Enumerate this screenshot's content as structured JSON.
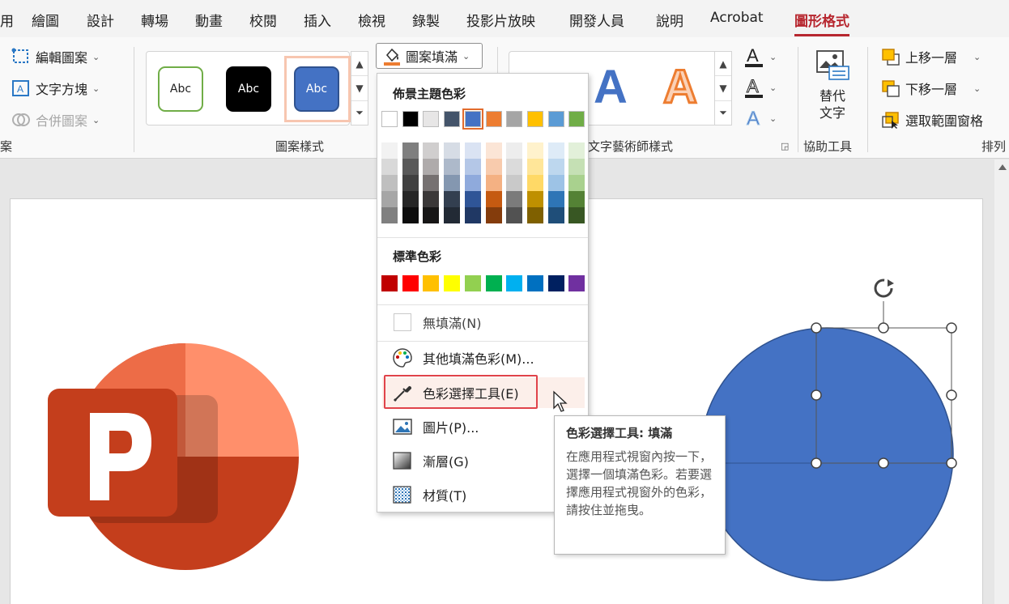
{
  "tabs": [
    "用",
    "繪圖",
    "設計",
    "轉場",
    "動畫",
    "校閱",
    "插入",
    "檢視",
    "錄製",
    "投影片放映",
    "開發人員",
    "說明",
    "Acrobat",
    "圖形格式"
  ],
  "active_tab": "圖形格式",
  "ribbon": {
    "insert_shapes": {
      "edit_shape": "編輯圖案",
      "text_box": "文字方塊",
      "merge_shapes": "合併圖案",
      "label_partial": "案"
    },
    "shape_styles": {
      "label": "圖案樣式",
      "presets": [
        "Abc",
        "Abc",
        "Abc"
      ],
      "fill_button": "圖案填滿"
    },
    "wordart": {
      "label": "文字藝術師樣式",
      "letters": [
        "A",
        "A"
      ]
    },
    "accessibility": {
      "alt_text_line1": "替代",
      "alt_text_line2": "文字",
      "label": "協助工具"
    },
    "arrange": {
      "bring_forward": "上移一層",
      "send_backward": "下移一層",
      "selection_pane": "選取範圍窗格",
      "label": "排列"
    }
  },
  "dropdown": {
    "theme_colors_header": "佈景主題色彩",
    "theme_colors": [
      "#ffffff",
      "#000000",
      "#e7e6e6",
      "#44546a",
      "#4472c4",
      "#ed7d31",
      "#a5a5a5",
      "#ffc000",
      "#5b9bd5",
      "#70ad47"
    ],
    "shades": [
      [
        "#f2f2f2",
        "#d9d9d9",
        "#bfbfbf",
        "#a6a6a6",
        "#808080"
      ],
      [
        "#7f7f7f",
        "#595959",
        "#404040",
        "#262626",
        "#0d0d0d"
      ],
      [
        "#d0cece",
        "#afabab",
        "#767171",
        "#3b3838",
        "#171616"
      ],
      [
        "#d6dce5",
        "#adb9ca",
        "#8497b0",
        "#333f50",
        "#222a35"
      ],
      [
        "#dae3f3",
        "#b4c7e7",
        "#8faadc",
        "#2f5597",
        "#203864"
      ],
      [
        "#fbe5d6",
        "#f8cbad",
        "#f4b183",
        "#c55a11",
        "#843c0c"
      ],
      [
        "#ededed",
        "#dbdbdb",
        "#c9c9c9",
        "#7b7b7b",
        "#525252"
      ],
      [
        "#fff2cc",
        "#ffe699",
        "#ffd966",
        "#bf9000",
        "#7f6000"
      ],
      [
        "#deebf7",
        "#bdd7ee",
        "#9dc3e6",
        "#2e75b6",
        "#1f4e79"
      ],
      [
        "#e2f0d9",
        "#c5e0b4",
        "#a9d18e",
        "#548235",
        "#385723"
      ]
    ],
    "standard_colors_header": "標準色彩",
    "standard_colors": [
      "#c00000",
      "#ff0000",
      "#ffc000",
      "#ffff00",
      "#92d050",
      "#00b050",
      "#00b0f0",
      "#0070c0",
      "#002060",
      "#7030a0"
    ],
    "no_fill": "無填滿(N)",
    "more_colors": "其他填滿色彩(M)...",
    "eyedropper": "色彩選擇工具(E)",
    "picture": "圖片(P)...",
    "gradient": "漸層(G)",
    "texture": "材質(T)"
  },
  "tooltip": {
    "title": "色彩選擇工具: 填滿",
    "body": "在應用程式視窗內按一下，選擇一個填滿色彩。若要選擇應用程式視窗外的色彩，請按住並拖曳。"
  },
  "colors": {
    "accent_red": "#b7272f",
    "shape_blue": "#4472c4"
  }
}
